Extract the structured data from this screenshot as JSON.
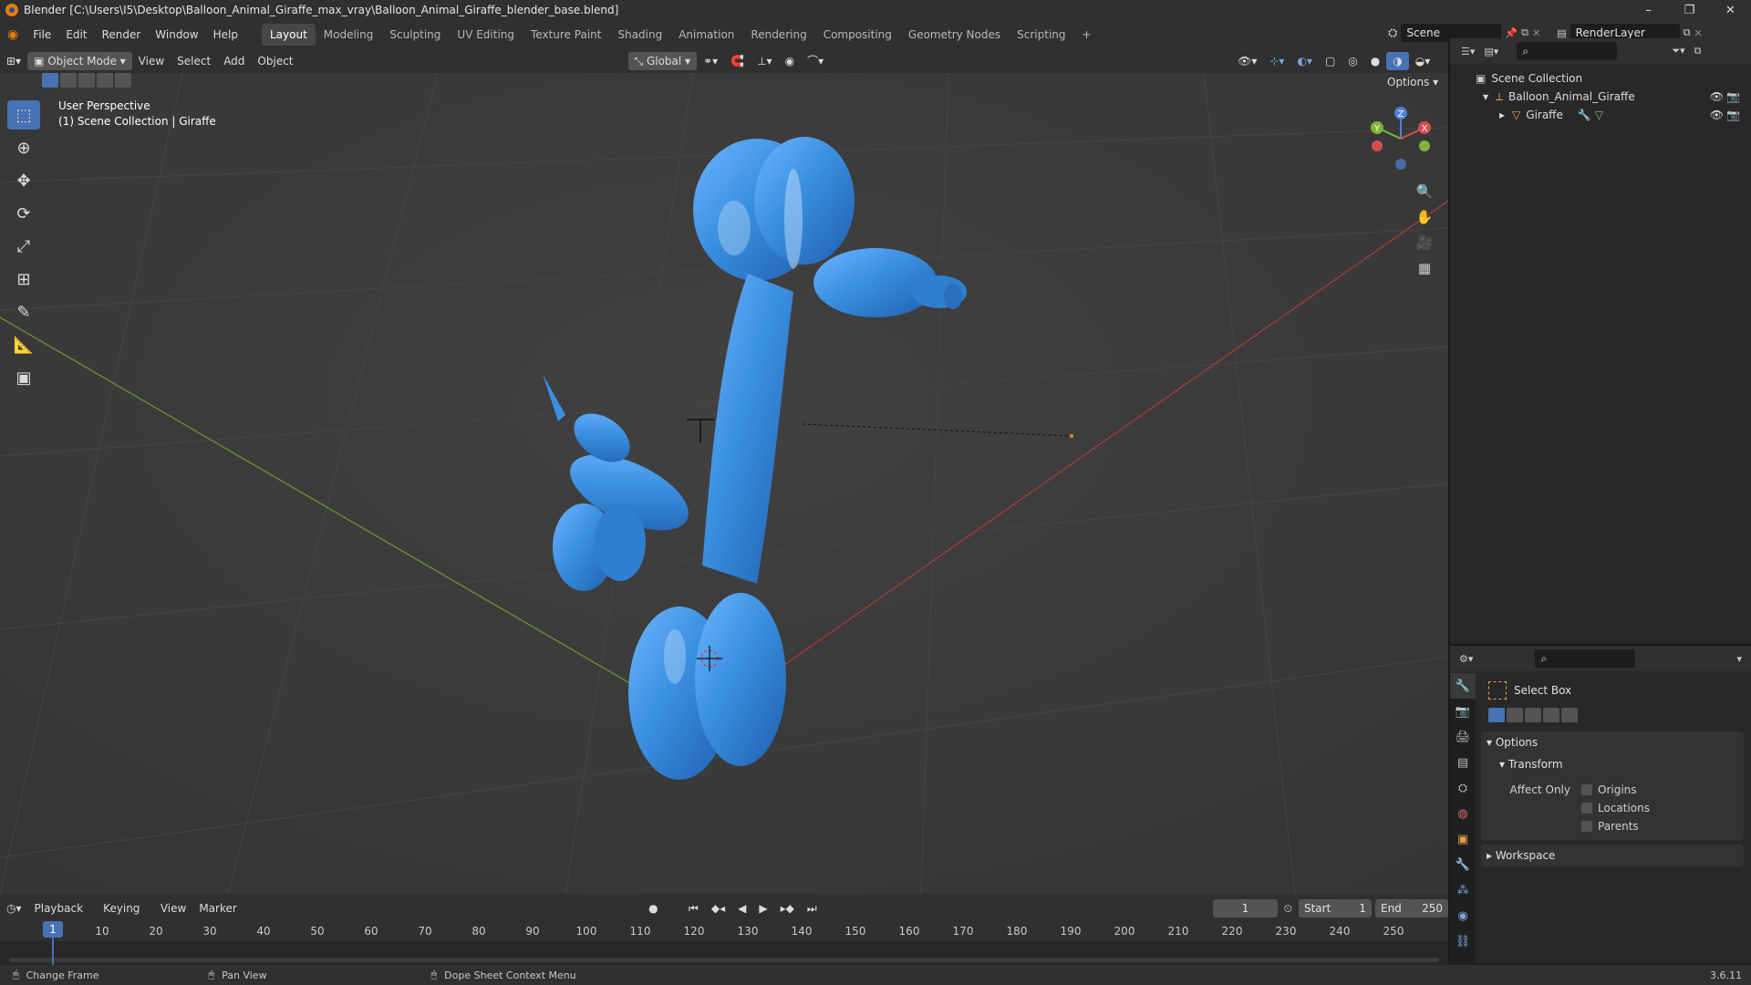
{
  "window": {
    "title": "Blender [C:\\Users\\I5\\Desktop\\Balloon_Animal_Giraffe_max_vray\\Balloon_Animal_Giraffe_blender_base.blend]",
    "controls": [
      "–",
      "❐",
      "✕"
    ]
  },
  "menu": {
    "items": [
      "File",
      "Edit",
      "Render",
      "Window",
      "Help"
    ]
  },
  "workspaces": {
    "tabs": [
      "Layout",
      "Modeling",
      "Sculpting",
      "UV Editing",
      "Texture Paint",
      "Shading",
      "Animation",
      "Rendering",
      "Compositing",
      "Geometry Nodes",
      "Scripting"
    ],
    "active": "Layout",
    "add": "+"
  },
  "scene": {
    "name": "Scene",
    "view_layer": "RenderLayer"
  },
  "header3d": {
    "mode": "Object Mode",
    "menus": [
      "View",
      "Select",
      "Add",
      "Object"
    ],
    "orientation": "Global",
    "options": "Options"
  },
  "viewport": {
    "perspective": "User Perspective",
    "collection_line": "(1) Scene Collection | Giraffe",
    "giraffe_color": "#3a8fe0",
    "gizmo_axes": {
      "x": "X",
      "y": "Y",
      "z": "Z"
    }
  },
  "toolbar": {
    "tools": [
      "select-box",
      "cursor",
      "move",
      "rotate",
      "scale",
      "transform",
      "annotate",
      "measure",
      "add-cube"
    ],
    "active": "select-box"
  },
  "outliner": {
    "root": "Scene Collection",
    "items": [
      {
        "label": "Balloon_Animal_Giraffe",
        "indent": 1
      },
      {
        "label": "Giraffe",
        "indent": 2
      }
    ]
  },
  "properties": {
    "tool_name": "Select Box",
    "panels": {
      "options": "Options",
      "transform": "Transform",
      "affect_only": "Affect Only",
      "workspace": "Workspace"
    },
    "checkboxes": [
      "Origins",
      "Locations",
      "Parents"
    ]
  },
  "timeline": {
    "menus": [
      "Playback",
      "Keying",
      "View",
      "Marker"
    ],
    "current_frame": "1",
    "start_label": "Start",
    "start": "1",
    "end_label": "End",
    "end": "250",
    "ticks": [
      "10",
      "20",
      "30",
      "40",
      "50",
      "60",
      "70",
      "80",
      "90",
      "100",
      "110",
      "120",
      "130",
      "140",
      "150",
      "160",
      "170",
      "180",
      "190",
      "200",
      "210",
      "220",
      "230",
      "240",
      "250"
    ]
  },
  "status": {
    "left": "Change Frame",
    "mid": "Pan View",
    "right": "Dope Sheet Context Menu",
    "version": "3.6.11"
  }
}
